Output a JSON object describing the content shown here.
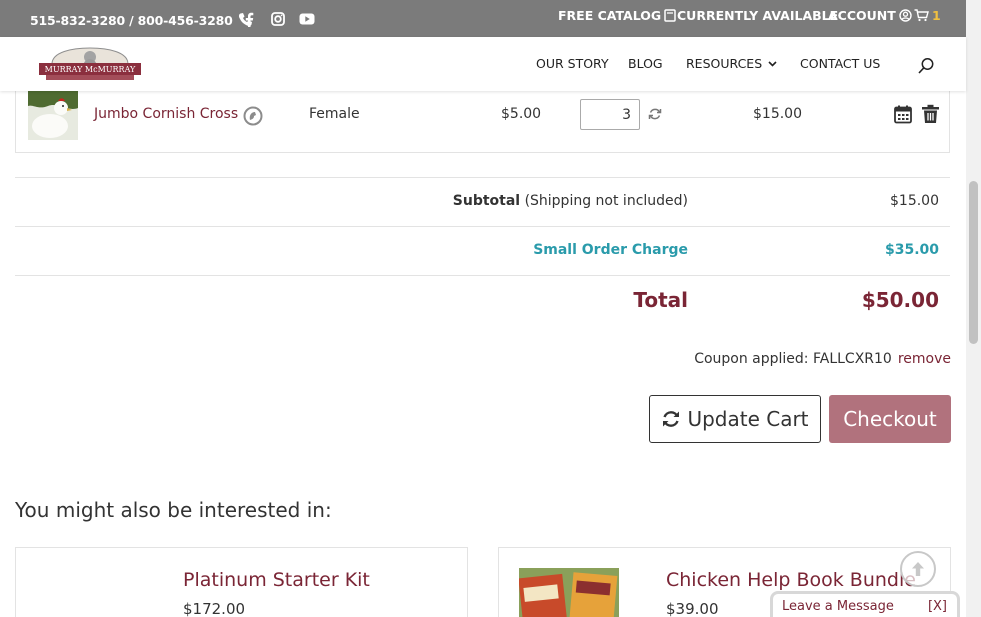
{
  "topbar": {
    "phone": "515-832-3280 / 800-456-3280",
    "free_catalog": "FREE CATALOG",
    "currently_available": "CURRENTLY AVAILABLE",
    "account": "ACCOUNT",
    "cart_count": "1"
  },
  "header": {
    "logo_text": "MURRAY McMURRAY",
    "nav": [
      "OUR STORY",
      "BLOG",
      "RESOURCES",
      "CONTACT US"
    ]
  },
  "cart": {
    "items": [
      {
        "name": "Jumbo Cornish Cross",
        "sex": "Female",
        "price": "$5.00",
        "quantity": "3",
        "total": "$15.00"
      }
    ],
    "subtotal_label": "Subtotal",
    "subtotal_note": "(Shipping not included)",
    "subtotal_value": "$15.00",
    "small_order_label": "Small Order Charge",
    "small_order_value": "$35.00",
    "total_label": "Total",
    "total_value": "$50.00",
    "coupon_text": "Coupon applied: FALLCXR10",
    "coupon_remove": "remove",
    "update_label": "Update Cart",
    "checkout_label": "Checkout"
  },
  "related": {
    "heading": "You might also be interested in:",
    "products": [
      {
        "title": "Platinum Starter Kit",
        "price": "$172.00"
      },
      {
        "title": "Chicken Help Book Bundle",
        "price": "$39.00"
      }
    ]
  },
  "chat": {
    "label": "Leave a Message",
    "close": "[X]"
  },
  "colors": {
    "topbar": "#7b7b7b",
    "maroon": "#7a2535",
    "teal": "#2a9bab",
    "checkout": "#b1727d"
  },
  "icons": [
    "phone-icon",
    "facebook-icon",
    "instagram-icon",
    "youtube-icon",
    "catalog-icon",
    "account-icon",
    "cart-icon",
    "search-icon",
    "refresh-icon",
    "calendar-icon",
    "trash-icon",
    "arrow-up-icon"
  ]
}
